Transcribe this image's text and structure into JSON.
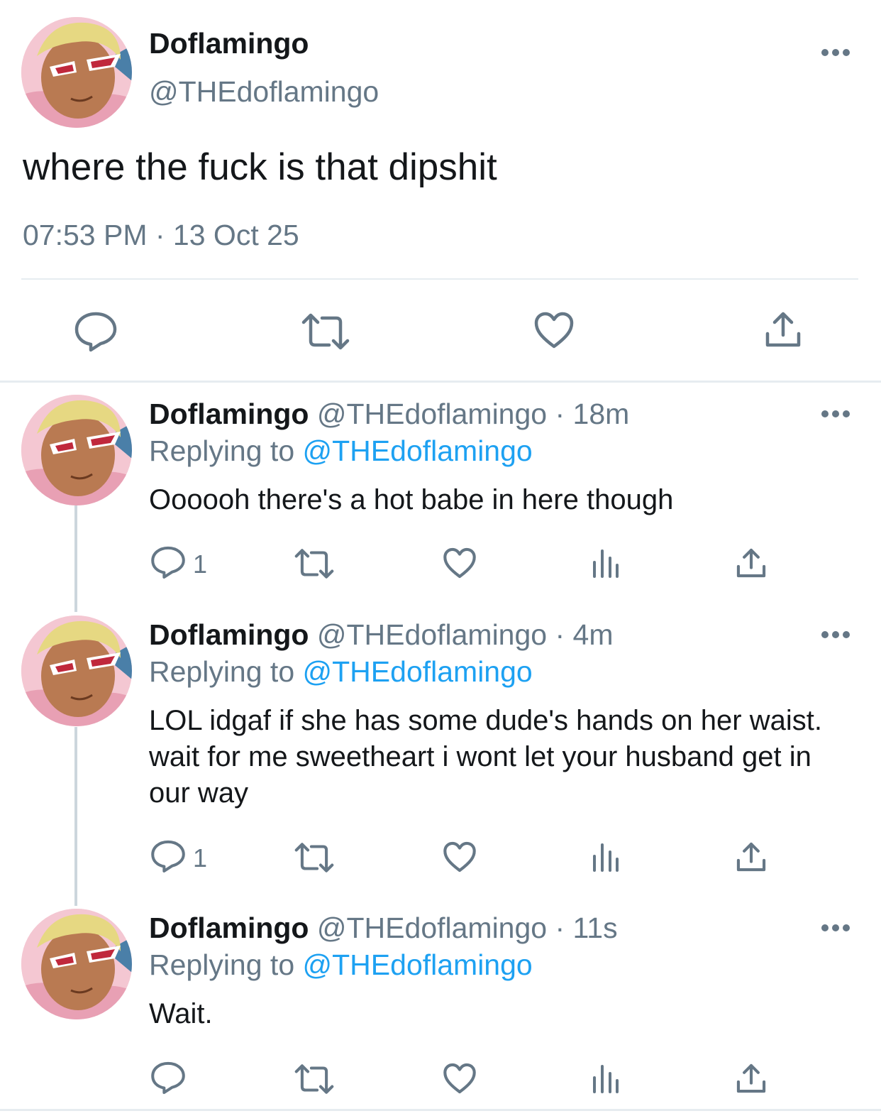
{
  "main_tweet": {
    "display_name": "Doflamingo",
    "handle": "@THEdoflamingo",
    "text": "where the fuck is that dipshit",
    "timestamp": "07:53 PM · 13 Oct 25",
    "actions": [
      "reply-icon",
      "retweet-icon",
      "like-icon",
      "share-icon"
    ]
  },
  "replies": [
    {
      "display_name": "Doflamingo",
      "meta": "@THEdoflamingo · 18m",
      "replying_prefix": "Replying to ",
      "replying_handle": "@THEdoflamingo",
      "text": "Oooooh there's a hot babe in here though",
      "reply_count": "1"
    },
    {
      "display_name": "Doflamingo",
      "meta": "@THEdoflamingo · 4m",
      "replying_prefix": "Replying to ",
      "replying_handle": "@THEdoflamingo",
      "text": "LOL idgaf if she has some dude's hands on her waist. wait for me sweetheart i wont let your husband get in our way",
      "reply_count": "1"
    },
    {
      "display_name": "Doflamingo",
      "meta": "@THEdoflamingo · 11s",
      "replying_prefix": "Replying to ",
      "replying_handle": "@THEdoflamingo",
      "text": "Wait.",
      "reply_count": ""
    }
  ],
  "colors": {
    "text": "#14171a",
    "secondary": "#657786",
    "link": "#1da1f2",
    "divider": "#e6ecf0",
    "thread_line": "#ccd6dd"
  }
}
